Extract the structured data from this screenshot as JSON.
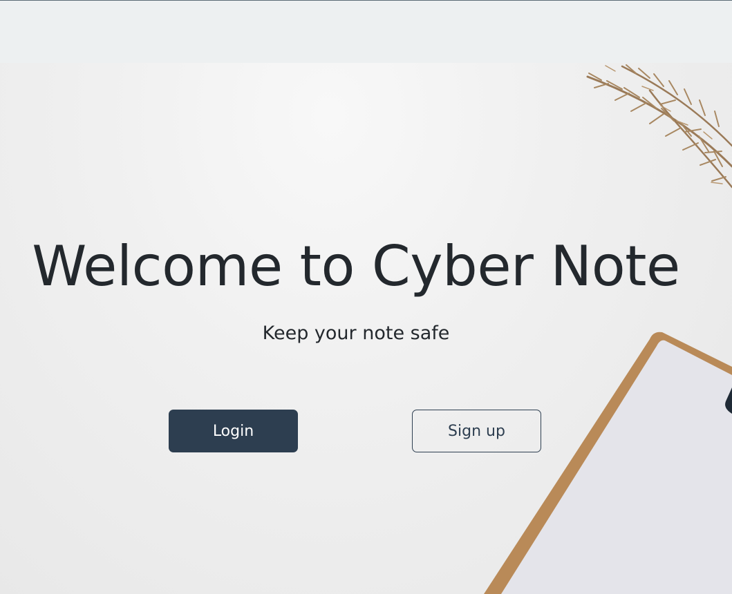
{
  "hero": {
    "title": "Welcome to Cyber Note",
    "tagline": "Keep your note safe"
  },
  "actions": {
    "login_label": "Login",
    "signup_label": "Sign up"
  },
  "colors": {
    "topbar_bg": "#edf0f1",
    "primary": "#2d3e50",
    "text": "#23282d"
  }
}
